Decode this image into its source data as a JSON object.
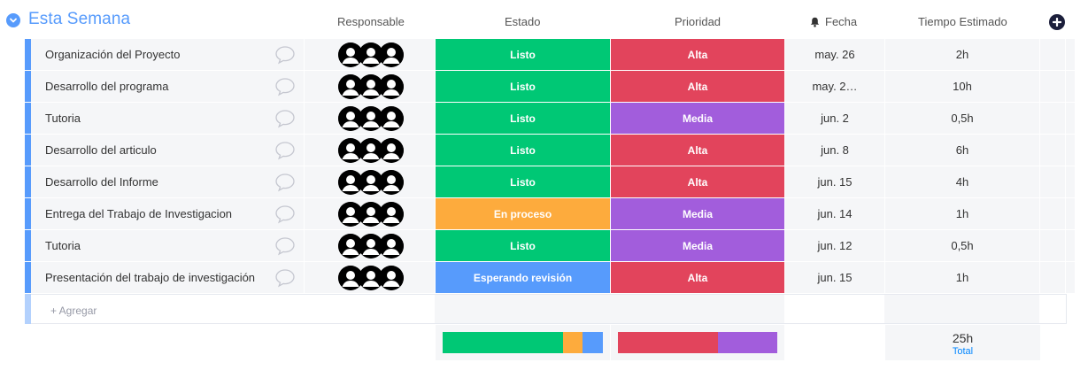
{
  "group": {
    "title": "Esta Semana",
    "color": "#579bfc"
  },
  "columns": {
    "responsable": "Responsable",
    "estado": "Estado",
    "prioridad": "Prioridad",
    "fecha": "Fecha",
    "tiempo": "Tiempo Estimado"
  },
  "colors": {
    "listo": "#00c875",
    "en_proceso": "#fdab3d",
    "esperando": "#579bfc",
    "alta": "#e2445c",
    "media": "#a25ddc"
  },
  "rows": [
    {
      "name": "Organización del Proyecto",
      "estado": "Listo",
      "estado_color": "#00c875",
      "prioridad": "Alta",
      "prioridad_color": "#e2445c",
      "fecha": "may. 26",
      "tiempo": "2h"
    },
    {
      "name": "Desarrollo del programa",
      "estado": "Listo",
      "estado_color": "#00c875",
      "prioridad": "Alta",
      "prioridad_color": "#e2445c",
      "fecha": "may. 2…",
      "tiempo": "10h"
    },
    {
      "name": "Tutoria",
      "estado": "Listo",
      "estado_color": "#00c875",
      "prioridad": "Media",
      "prioridad_color": "#a25ddc",
      "fecha": "jun. 2",
      "tiempo": "0,5h"
    },
    {
      "name": "Desarrollo del articulo",
      "estado": "Listo",
      "estado_color": "#00c875",
      "prioridad": "Alta",
      "prioridad_color": "#e2445c",
      "fecha": "jun. 8",
      "tiempo": "6h"
    },
    {
      "name": "Desarrollo del Informe",
      "estado": "Listo",
      "estado_color": "#00c875",
      "prioridad": "Alta",
      "prioridad_color": "#e2445c",
      "fecha": "jun. 15",
      "tiempo": "4h"
    },
    {
      "name": "Entrega del Trabajo de Investigacion",
      "estado": "En proceso",
      "estado_color": "#fdab3d",
      "prioridad": "Media",
      "prioridad_color": "#a25ddc",
      "fecha": "jun. 14",
      "tiempo": "1h"
    },
    {
      "name": "Tutoria",
      "estado": "Listo",
      "estado_color": "#00c875",
      "prioridad": "Media",
      "prioridad_color": "#a25ddc",
      "fecha": "jun. 12",
      "tiempo": "0,5h"
    },
    {
      "name": "Presentación del trabajo de investigación",
      "estado": "Esperando revisión",
      "estado_color": "#579bfc",
      "prioridad": "Alta",
      "prioridad_color": "#e2445c",
      "fecha": "jun. 15",
      "tiempo": "1h"
    }
  ],
  "add_row": {
    "label": "+ Agregar"
  },
  "summary": {
    "estado_distribution": [
      {
        "label": "Listo",
        "fraction": 0.75,
        "color": "#00c875"
      },
      {
        "label": "En proceso",
        "fraction": 0.125,
        "color": "#fdab3d"
      },
      {
        "label": "Esperando revisión",
        "fraction": 0.125,
        "color": "#579bfc"
      }
    ],
    "prioridad_distribution": [
      {
        "label": "Alta",
        "fraction": 0.625,
        "color": "#e2445c"
      },
      {
        "label": "Media",
        "fraction": 0.375,
        "color": "#a25ddc"
      }
    ],
    "total_value": "25h",
    "total_label": "Total"
  },
  "icons": {
    "group_toggle": "chevron-down-icon",
    "comment": "speech-bubble-icon",
    "avatar": "person-icon",
    "fecha": "bell-icon",
    "add_column": "plus-circle-icon"
  }
}
